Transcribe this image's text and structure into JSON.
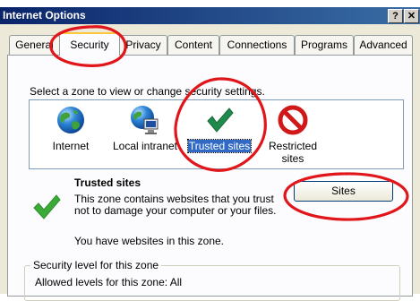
{
  "caption": "",
  "window": {
    "title": "Internet Options",
    "help_label": "?",
    "close_label": "✕"
  },
  "tabs": [
    "General",
    "Security",
    "Privacy",
    "Content",
    "Connections",
    "Programs",
    "Advanced"
  ],
  "active_tab": "Security",
  "zone_instruction": "Select a zone to view or change security settings.",
  "zones": [
    {
      "label": "Internet",
      "icon": "globe-icon"
    },
    {
      "label": "Local intranet",
      "icon": "intranet-icon"
    },
    {
      "label": "Trusted sites",
      "icon": "checkmark-icon",
      "selected": true
    },
    {
      "label": "Restricted sites",
      "icon": "restricted-icon"
    }
  ],
  "zone_description": {
    "title": "Trusted sites",
    "text": "This zone contains websites that you trust not to damage your computer or your files.",
    "note": "You have websites in this zone."
  },
  "sites_button": "Sites",
  "security_level": {
    "legend": "Security level for this zone",
    "allowed": "Allowed levels for this zone: All"
  },
  "colors": {
    "annotation": "#e0161b",
    "selection": "#316ac5",
    "check": "#3bab37"
  }
}
